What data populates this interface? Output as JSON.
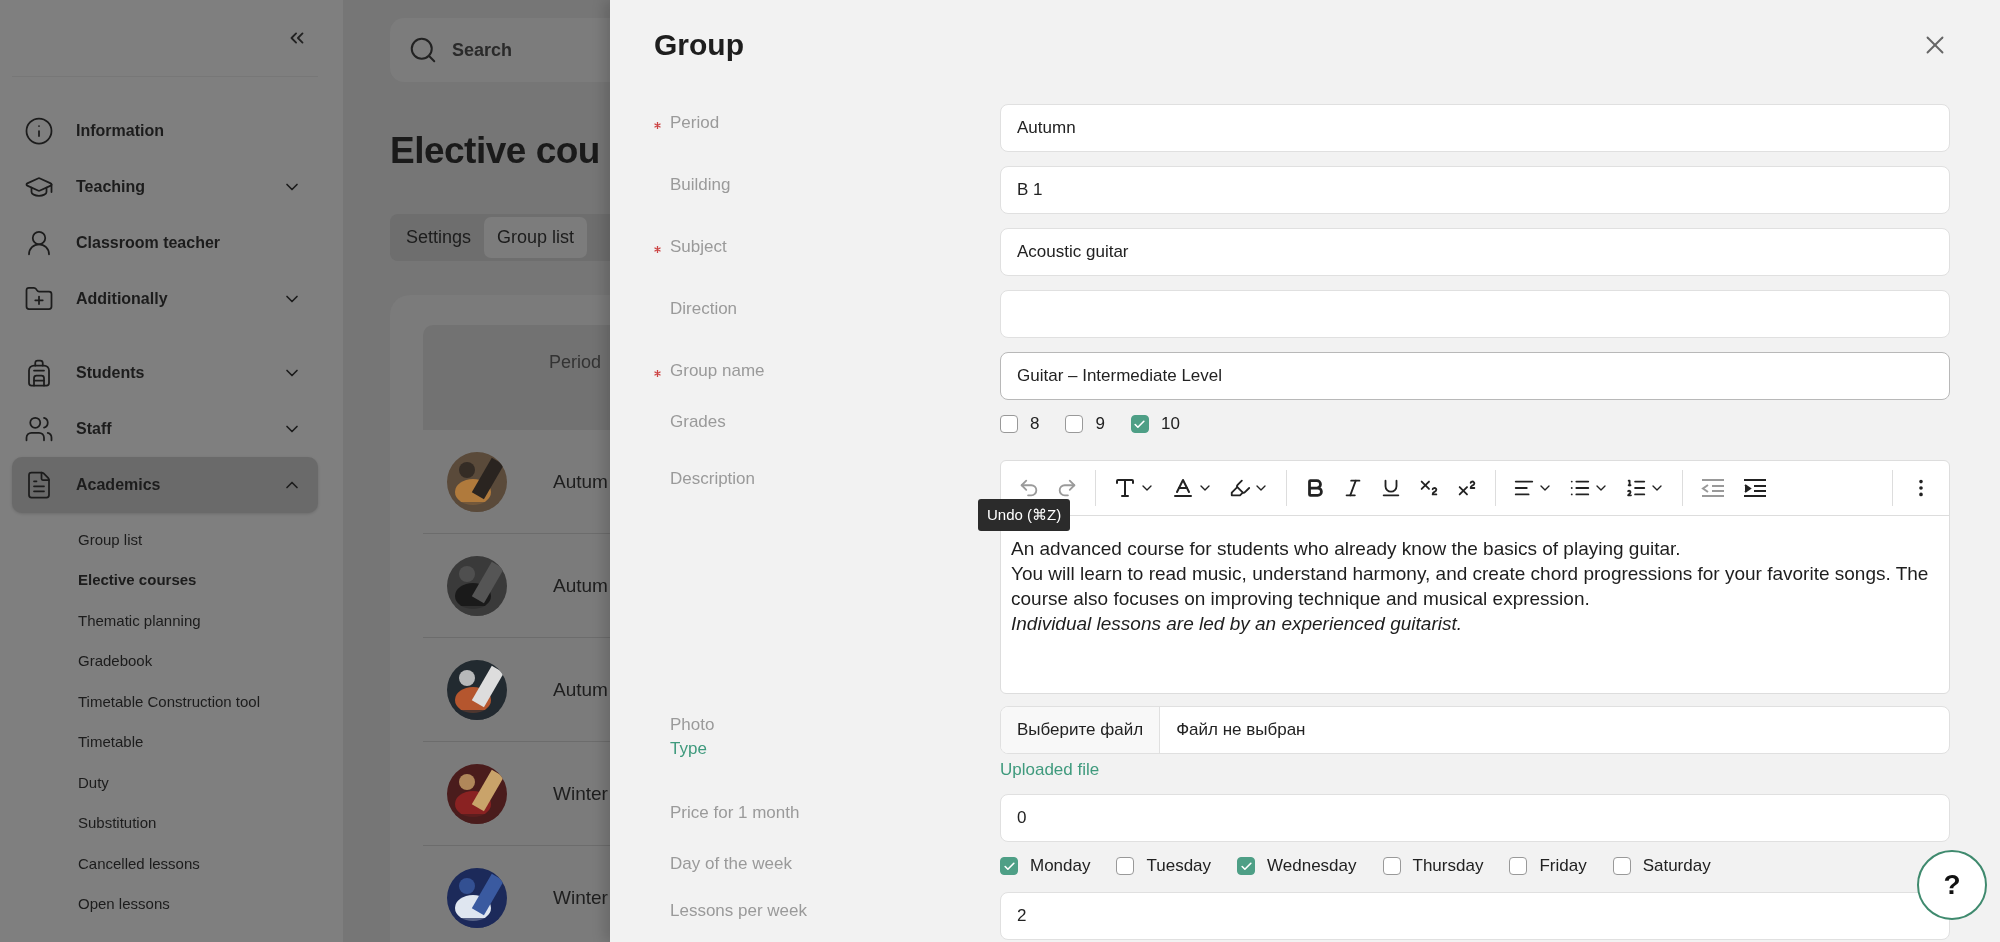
{
  "sidebar": {
    "sections": [
      {
        "items": [
          {
            "kind": "link",
            "label": "Information",
            "selected": false
          },
          {
            "kind": "group",
            "label": "Teaching",
            "selected": false,
            "expanded": false
          },
          {
            "kind": "link",
            "label": "Classroom teacher",
            "selected": false
          },
          {
            "kind": "group",
            "label": "Additionally",
            "selected": false,
            "expanded": false
          }
        ]
      },
      {
        "items": [
          {
            "kind": "group",
            "label": "Students",
            "selected": false,
            "expanded": false
          },
          {
            "kind": "group",
            "label": "Staff",
            "selected": false,
            "expanded": false
          },
          {
            "kind": "group",
            "label": "Academics",
            "selected": true,
            "expanded": true,
            "children": [
              {
                "label": "Group list",
                "selected": false
              },
              {
                "label": "Elective courses",
                "selected": true
              },
              {
                "label": "Thematic planning",
                "selected": false
              },
              {
                "label": "Gradebook",
                "selected": false
              },
              {
                "label": "Timetable Construction tool",
                "selected": false
              },
              {
                "label": "Timetable",
                "selected": false
              },
              {
                "label": "Duty",
                "selected": false
              },
              {
                "label": "Substitution",
                "selected": false
              },
              {
                "label": "Cancelled lessons",
                "selected": false
              },
              {
                "label": "Open lessons",
                "selected": false
              }
            ]
          }
        ]
      }
    ]
  },
  "main": {
    "search": {
      "placeholder": "Search"
    },
    "title": "Elective cou",
    "tabs": [
      {
        "label": "Settings",
        "selected": false
      },
      {
        "label": "Group list",
        "selected": true
      }
    ],
    "table": {
      "columns": [
        "Period"
      ],
      "rows": [
        {
          "period": "Autum"
        },
        {
          "period": "Autum"
        },
        {
          "period": "Autum"
        },
        {
          "period": "Winter"
        },
        {
          "period": "Winter"
        }
      ]
    }
  },
  "drawer": {
    "title": "Group",
    "fields": [
      {
        "kind": "text",
        "label": "Period",
        "required": true,
        "value": "Autumn",
        "focused": false
      },
      {
        "kind": "text",
        "label": "Building",
        "required": false,
        "value": "B 1",
        "focused": false
      },
      {
        "kind": "text",
        "label": "Subject",
        "required": true,
        "value": "Acoustic guitar",
        "focused": false
      },
      {
        "kind": "text",
        "label": "Direction",
        "required": false,
        "focused": false
      },
      {
        "kind": "text",
        "label": "Group name",
        "required": true,
        "value": "Guitar – Intermediate Level",
        "focused": true
      },
      {
        "kind": "checks",
        "label": "Grades",
        "required": false,
        "options": [
          {
            "label": "8",
            "checked": false
          },
          {
            "label": "9",
            "checked": false
          },
          {
            "label": "10",
            "checked": true
          }
        ]
      },
      {
        "kind": "editor",
        "label": "Description",
        "required": false,
        "tooltip": "Undo (⌘Z)",
        "paragraphs": [
          {
            "text": "An advanced course for students who already know the basics of playing guitar.",
            "italic": false
          },
          {
            "text": "You will learn to read music, understand harmony, and create chord progressions for your favorite songs. The course also focuses on improving technique and musical expression.",
            "italic": false
          },
          {
            "text": "Individual lessons are led by an experienced guitarist.",
            "italic": true
          }
        ]
      },
      {
        "kind": "file",
        "label": "Photo",
        "required": false,
        "link": "Type",
        "button": "Выберите файл",
        "status": "Файл не выбран",
        "uploaded": "Uploaded file"
      },
      {
        "kind": "text",
        "label": "Price for 1 month",
        "required": false,
        "value": "0",
        "focused": false
      },
      {
        "kind": "checks",
        "label": "Day of the week",
        "required": false,
        "options": [
          {
            "label": "Monday",
            "checked": true
          },
          {
            "label": "Tuesday",
            "checked": false
          },
          {
            "label": "Wednesday",
            "checked": true
          },
          {
            "label": "Thursday",
            "checked": false
          },
          {
            "label": "Friday",
            "checked": false
          },
          {
            "label": "Saturday",
            "checked": false
          }
        ]
      },
      {
        "kind": "text",
        "label": "Lessons per week",
        "required": false,
        "value": "2",
        "focused": false
      }
    ]
  },
  "help": {
    "label": "?"
  }
}
